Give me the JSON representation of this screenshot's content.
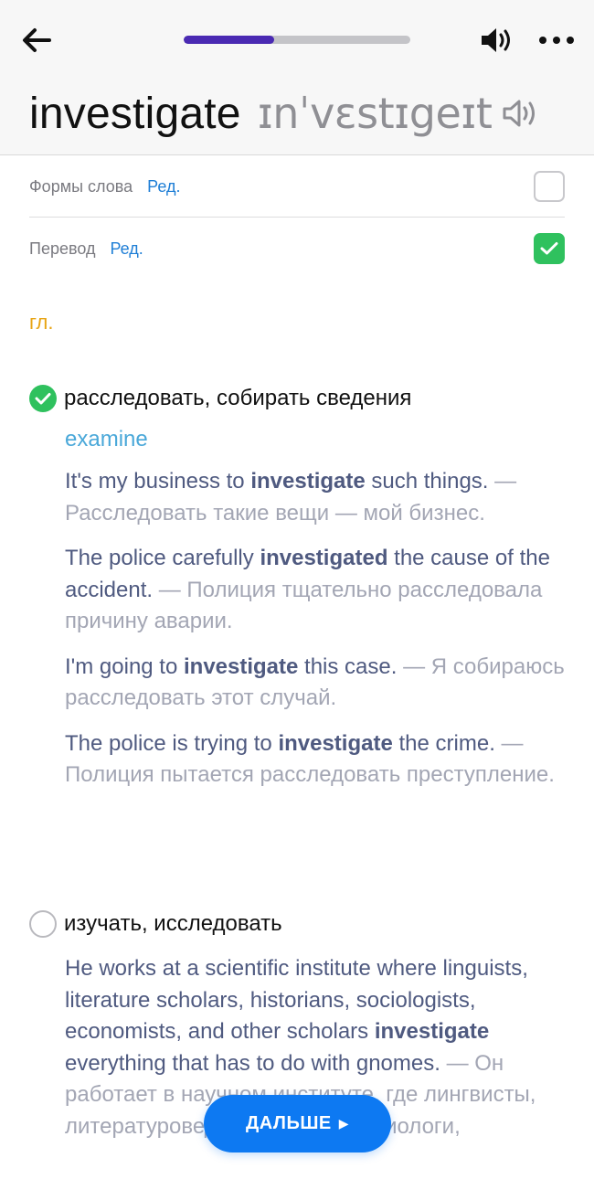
{
  "header": {
    "back_icon": "arrow-left-icon",
    "progress": 0.4,
    "progress_color": "#4a2ab3",
    "sound_icon": "speaker-icon",
    "more_icon": "more-dots-icon"
  },
  "word": {
    "text": "investigate",
    "transcription": "ɪnˈvɛstɪgeɪt",
    "sound_icon": "speaker-outline-icon"
  },
  "options": [
    {
      "label": "Формы слова",
      "edit": "Ред.",
      "checked": false
    },
    {
      "label": "Перевод",
      "edit": "Ред.",
      "checked": true
    }
  ],
  "part_of_speech": "гл.",
  "senses": [
    {
      "title": "расследовать, собирать сведения",
      "selected": true,
      "synonym": "examine",
      "examples": [
        {
          "en_before": "It's my business to ",
          "en_bold": "investigate",
          "en_after": " such things.",
          "ru": "— Расследовать такие вещи — мой бизнес."
        },
        {
          "en_before": "The police carefully ",
          "en_bold": "investigated",
          "en_after": " the cause of the accident.",
          "ru": "— Полиция тщательно расследовала причину аварии."
        },
        {
          "en_before": "I'm going to ",
          "en_bold": "investigate",
          "en_after": " this case.",
          "ru": "— Я собираюсь расследовать этот случай."
        },
        {
          "en_before": "The police is trying to ",
          "en_bold": "investigate",
          "en_after": " the crime.",
          "ru": "— Полиция пытается расследовать преступление."
        }
      ]
    },
    {
      "title": "изучать, исследовать",
      "selected": false,
      "synonym": "",
      "examples": [
        {
          "en_before": "He works at a scientific institute where linguists, literature scholars, historians, sociologists, economists, and other scholars ",
          "en_bold": "investigate",
          "en_after": " everything that has to do with gnomes.",
          "ru": "— Он работает в научном институте, где лингвисты, литературоведы, историки, социологи,"
        }
      ]
    }
  ],
  "next_button": {
    "label": "ДАЛЬШЕ",
    "arrow": "▶",
    "color": "#0d79f2"
  }
}
